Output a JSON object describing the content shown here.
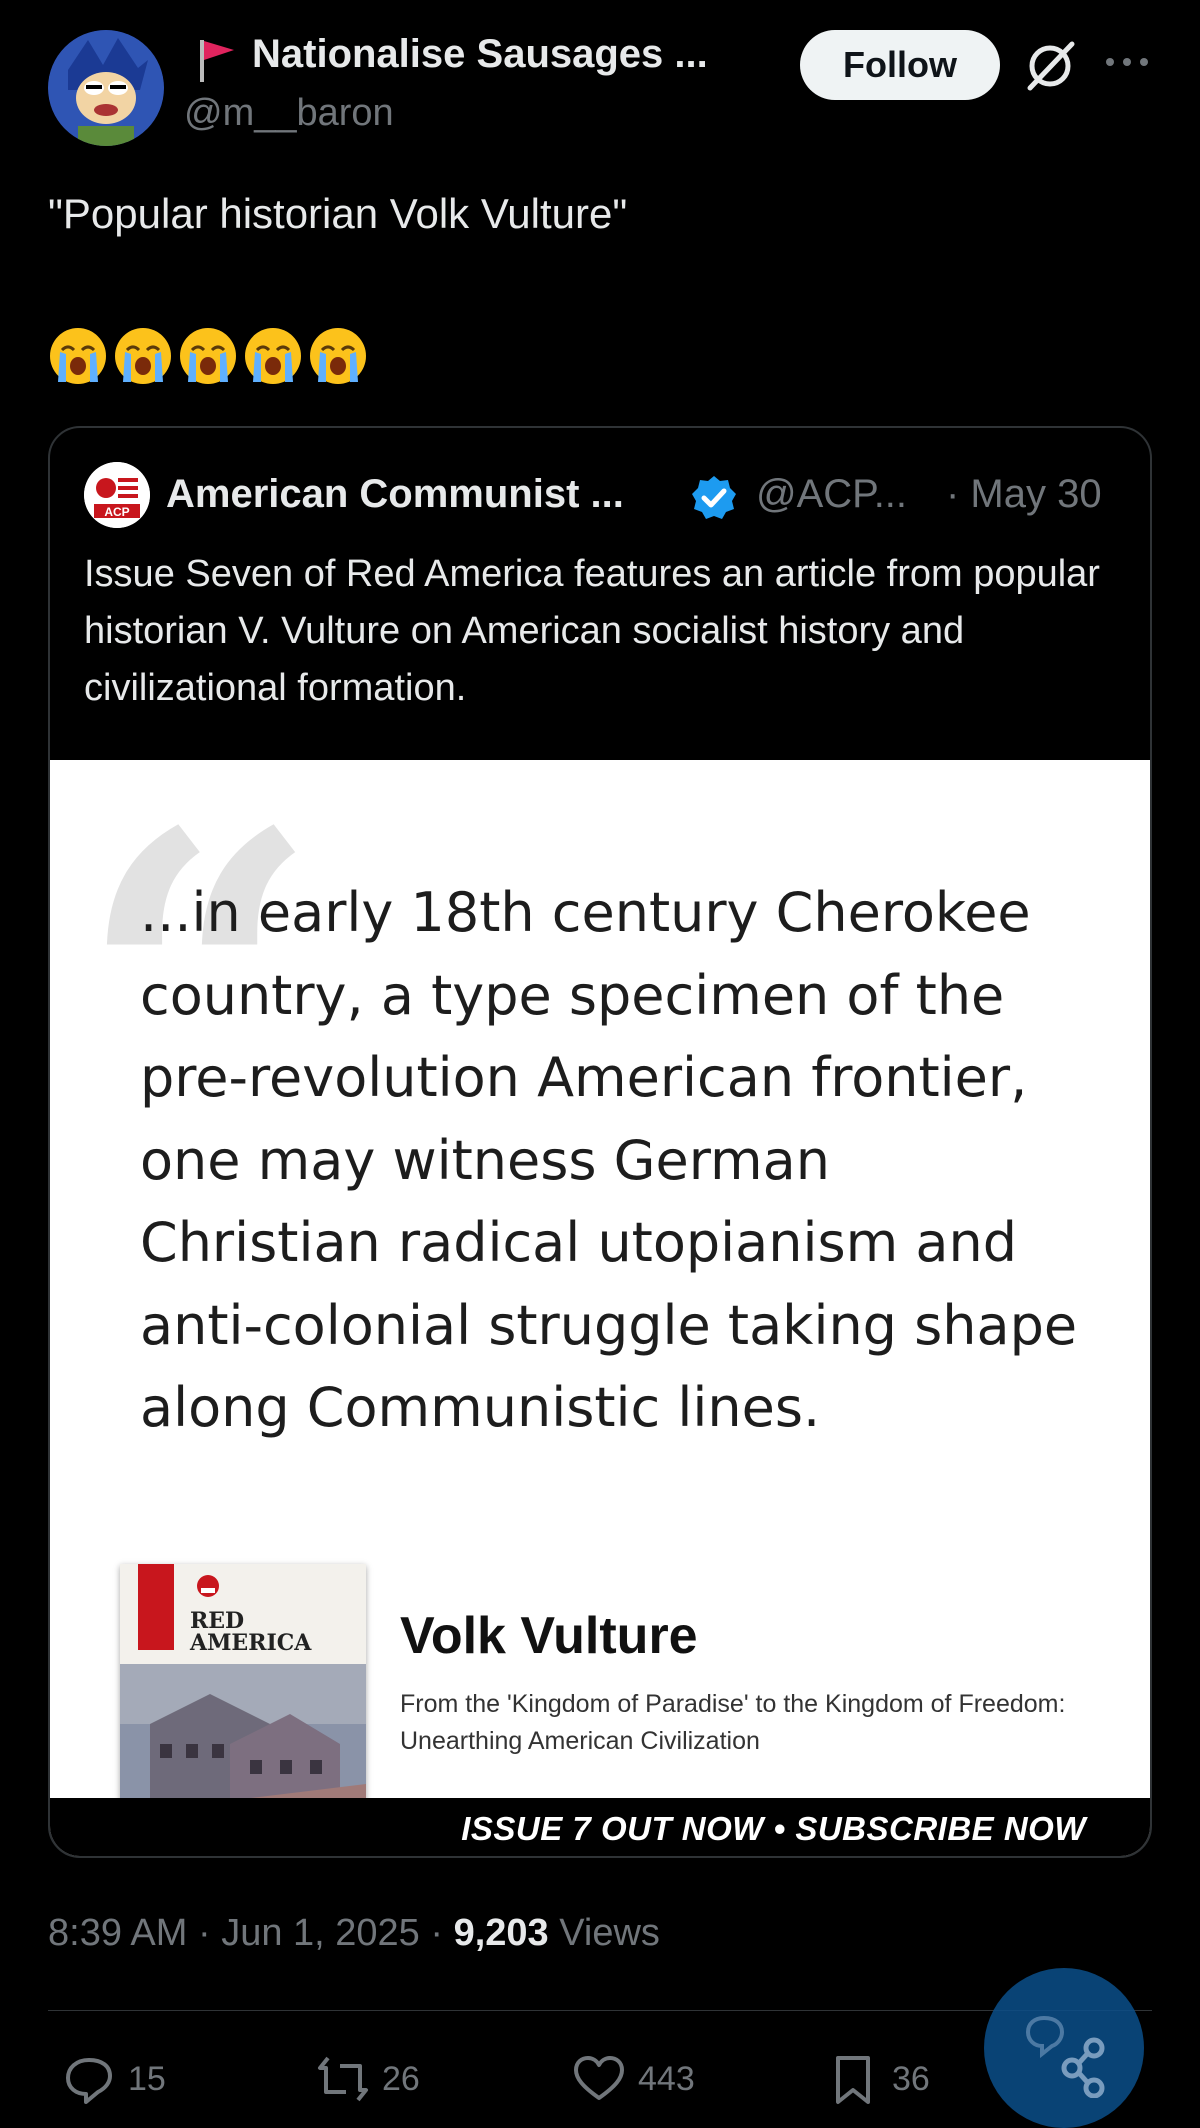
{
  "author": {
    "display_name": "Nationalise Sausages ...",
    "handle": "@m__baron",
    "flag_icon": "red-flag-icon",
    "follow_label": "Follow"
  },
  "tweet": {
    "text": "\"Popular historian Volk Vulture\"",
    "emoji": [
      "😭",
      "😭",
      "😭",
      "😭",
      "😭"
    ]
  },
  "quoted": {
    "display_name": "American Communist ...",
    "handle": "@ACP...",
    "date": "· May 30",
    "verified_color": "#1d9bf0",
    "text": "Issue Seven of Red America features an article from popular historian V. Vulture on American socialist history and civilizational formation.",
    "image": {
      "excerpt": "...in early 18th century Cherokee country, a type specimen of the pre-revolution American frontier, one may witness German Christian radical utopianism and anti-colonial struggle taking shape along Communistic lines.",
      "magazine_logo": "ACP",
      "magazine_title_line1": "RED",
      "magazine_title_line2": "AMERICA",
      "article_author": "Volk Vulture",
      "article_title": "From the 'Kingdom of Paradise' to the Kingdom of Freedom: Unearthing American Civilization",
      "banner": "ISSUE 7 OUT NOW • SUBSCRIBE NOW"
    }
  },
  "meta": {
    "time": "8:39 AM · Jun 1, 2025 · ",
    "views_count": "9,203",
    "views_label": " Views"
  },
  "actions": {
    "replies": "15",
    "reposts": "26",
    "likes": "443",
    "bookmarks": "36"
  }
}
